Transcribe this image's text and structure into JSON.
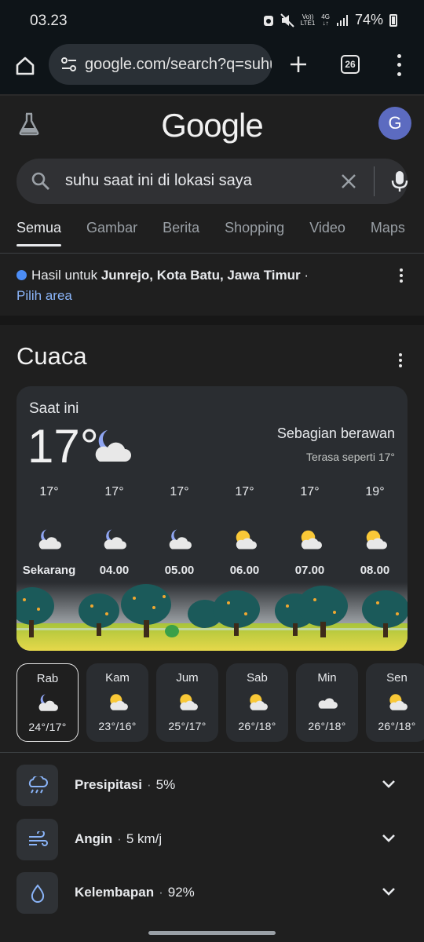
{
  "status_bar": {
    "time": "03.23",
    "volte": "Vo))",
    "lte": "LTE1",
    "network": "4G",
    "battery": "74%"
  },
  "browser": {
    "url": "google.com/search?q=suhu",
    "tab_count": "26"
  },
  "google": {
    "logo": "Google",
    "avatar_letter": "G",
    "avatar_color": "#5c6bc0",
    "query": "suhu saat ini di lokasi saya"
  },
  "tabs": [
    "Semua",
    "Gambar",
    "Berita",
    "Shopping",
    "Video",
    "Maps"
  ],
  "location": {
    "prefix": "Hasil untuk",
    "place": "Junrejo, Kota Batu, Jawa Timur",
    "suffix": " ·",
    "link": "Pilih area"
  },
  "weather": {
    "section_title": "Cuaca",
    "now_label": "Saat ini",
    "temperature": "17°",
    "condition": "Sebagian berawan",
    "feels_like": "Terasa seperti 17°",
    "hourly": [
      {
        "temp": "17°",
        "label": "Sekarang",
        "icon": "moon-cloud-icon"
      },
      {
        "temp": "17°",
        "label": "04.00",
        "icon": "moon-cloud-icon"
      },
      {
        "temp": "17°",
        "label": "05.00",
        "icon": "moon-cloud-icon"
      },
      {
        "temp": "17°",
        "label": "06.00",
        "icon": "sun-cloud-icon"
      },
      {
        "temp": "17°",
        "label": "07.00",
        "icon": "sun-cloud-icon"
      },
      {
        "temp": "19°",
        "label": "08.00",
        "icon": "sun-cloud-icon"
      }
    ],
    "daily": [
      {
        "day": "Rab",
        "range": "24°/17°",
        "icon": "moon-cloud-icon",
        "selected": true
      },
      {
        "day": "Kam",
        "range": "23°/16°",
        "icon": "sun-cloud-icon"
      },
      {
        "day": "Jum",
        "range": "25°/17°",
        "icon": "sun-cloud-icon"
      },
      {
        "day": "Sab",
        "range": "26°/18°",
        "icon": "sun-cloud-icon"
      },
      {
        "day": "Min",
        "range": "26°/18°",
        "icon": "cloud-icon"
      },
      {
        "day": "Sen",
        "range": "26°/18°",
        "icon": "sun-cloud-icon"
      }
    ],
    "details": [
      {
        "label": "Presipitasi",
        "value": "5%",
        "icon": "rain-icon"
      },
      {
        "label": "Angin",
        "value": "5 km/j",
        "icon": "wind-icon"
      },
      {
        "label": "Kelembapan",
        "value": "92%",
        "icon": "humidity-icon"
      }
    ]
  }
}
